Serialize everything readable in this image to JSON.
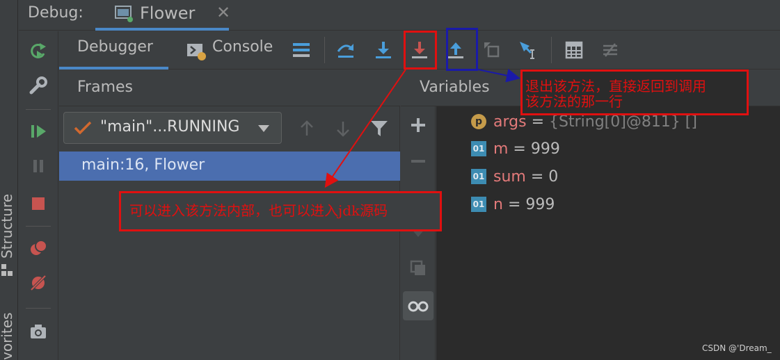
{
  "titlebar": {
    "debug_label": "Debug:",
    "tab_label": "Flower",
    "tab_close": "✕"
  },
  "gutter": {
    "structure_label": "Structure",
    "favorites_label": "vorites"
  },
  "toolbar": {
    "debugger_tab": "Debugger",
    "console_tab": "Console"
  },
  "frames": {
    "header": "Frames",
    "thread_value": "\"main\"...RUNNING",
    "selected_frame": "main:16, Flower"
  },
  "variables": {
    "header": "Variables",
    "items": [
      {
        "badge": "p",
        "name": "args",
        "value": "{String[0]@811} []"
      },
      {
        "badge": "01",
        "name": "m",
        "value": "999"
      },
      {
        "badge": "01",
        "name": "sum",
        "value": "0"
      },
      {
        "badge": "01",
        "name": "n",
        "value": "999"
      }
    ]
  },
  "annotations": {
    "step_out_note_line1": "退出该方法，直接返回到调用",
    "step_out_note_line2": "该方法的那一行",
    "force_step_into_note": "可以进入该方法内部，也可以进入jdk源码"
  },
  "watermark": "CSDN @'Dream_",
  "colors": {
    "accent_blue": "#4a88c7",
    "selected_row": "#4b6eaf",
    "annotation_red": "#e01010",
    "annotation_blue": "#1a1aa8",
    "resume_green": "#59a869",
    "stop_red": "#c75450"
  }
}
